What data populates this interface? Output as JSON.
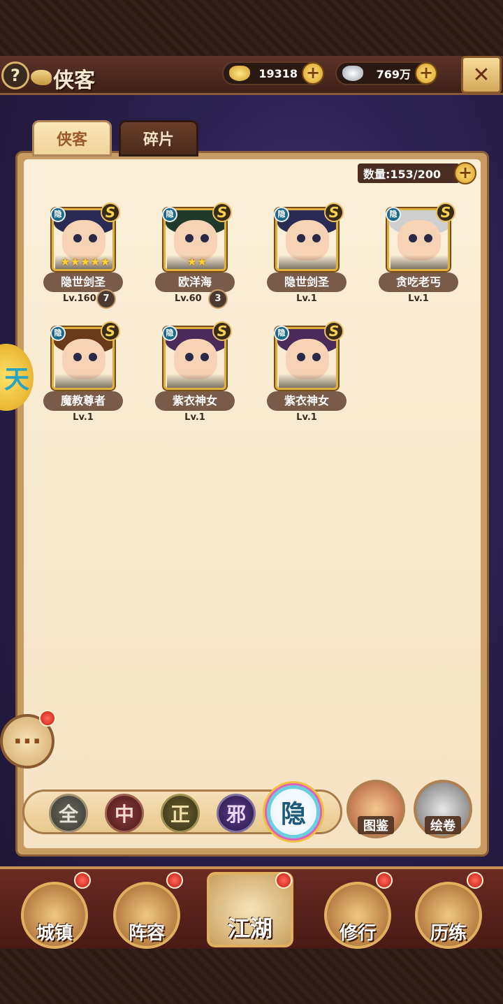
{
  "header": {
    "help_icon": "question-icon",
    "title": "侠客",
    "gold_value": "19318",
    "silver_value": "769万",
    "close_icon": "crossed-swords-icon"
  },
  "tabs": [
    {
      "label": "侠客",
      "active": true
    },
    {
      "label": "碎片",
      "active": false
    }
  ],
  "capacity": {
    "label": "数量:153/200"
  },
  "heroes": [
    {
      "name": "隐世剑圣",
      "level": "Lv.160",
      "stars": "★★★★★",
      "badge": "7",
      "tag": "隐",
      "grade": "S",
      "hair": "#2a2a55"
    },
    {
      "name": "欧洋海",
      "level": "Lv.60",
      "stars": "★★",
      "badge": "3",
      "tag": "隐",
      "grade": "S",
      "hair": "#1f3a2a"
    },
    {
      "name": "隐世剑圣",
      "level": "Lv.1",
      "stars": "",
      "badge": "",
      "tag": "隐",
      "grade": "S",
      "hair": "#2a2a55"
    },
    {
      "name": "贪吃老丐",
      "level": "Lv.1",
      "stars": "",
      "badge": "",
      "tag": "隐",
      "grade": "S",
      "hair": "#cfcfcf"
    },
    {
      "name": "魔教尊者",
      "level": "Lv.1",
      "stars": "",
      "badge": "",
      "tag": "隐",
      "grade": "S",
      "hair": "#6a3a1a"
    },
    {
      "name": "紫衣神女",
      "level": "Lv.1",
      "stars": "",
      "badge": "",
      "tag": "隐",
      "grade": "S",
      "hair": "#4a2a5a"
    },
    {
      "name": "紫衣神女",
      "level": "Lv.1",
      "stars": "",
      "badge": "",
      "tag": "隐",
      "grade": "S",
      "hair": "#4a2a5a"
    }
  ],
  "filters": [
    "全",
    "中",
    "正",
    "邪",
    "隐"
  ],
  "side_buttons": {
    "tujian": "图鉴",
    "huijuan": "绘卷"
  },
  "chat_icon": "chat-bubble-icon",
  "nav": {
    "town": "城镇",
    "team": "阵容",
    "jianghu": "江湖",
    "train": "修行",
    "exp": "历练"
  }
}
